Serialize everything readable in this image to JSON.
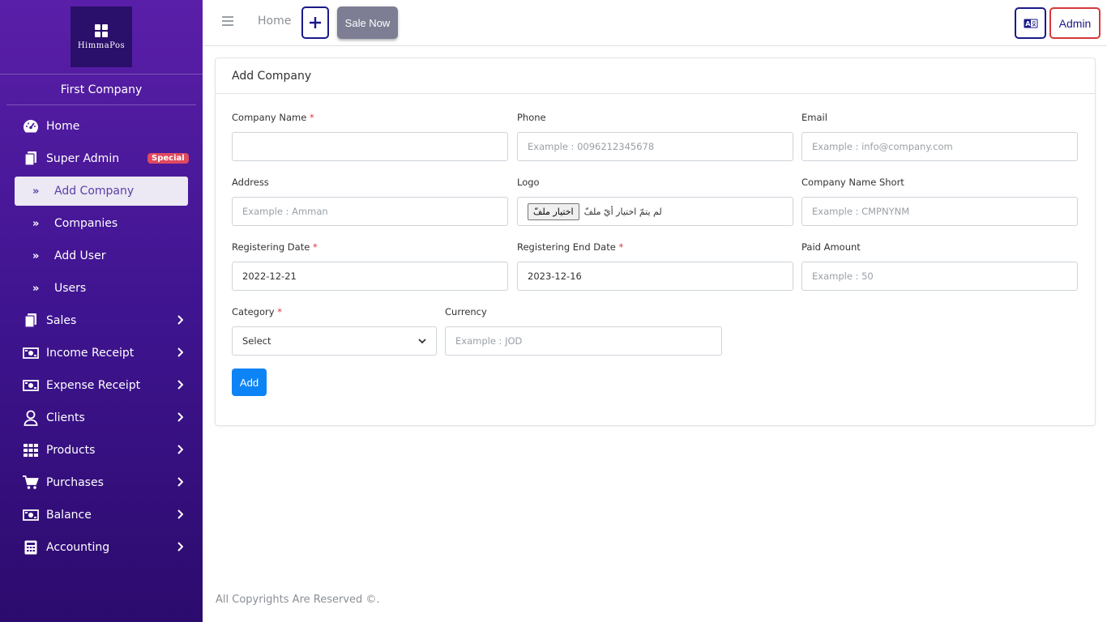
{
  "sidebar": {
    "logo_text": "HimmaPos",
    "company": "First Company",
    "items": [
      {
        "label": "Home",
        "icon": "dashboard-icon"
      },
      {
        "label": "Super Admin",
        "icon": "copy-icon",
        "badge": "Special"
      }
    ],
    "sub_items": [
      {
        "label": "Add Company"
      },
      {
        "label": "Companies"
      },
      {
        "label": "Add User"
      },
      {
        "label": "Users"
      }
    ],
    "menu": [
      {
        "label": "Sales",
        "icon": "copy-icon"
      },
      {
        "label": "Income Receipt",
        "icon": "money-icon"
      },
      {
        "label": "Expense Receipt",
        "icon": "money-icon"
      },
      {
        "label": "Clients",
        "icon": "user-icon"
      },
      {
        "label": "Products",
        "icon": "grid-icon"
      },
      {
        "label": "Purchases",
        "icon": "cart-icon"
      },
      {
        "label": "Balance",
        "icon": "money-icon"
      },
      {
        "label": "Accounting",
        "icon": "calculator-icon"
      }
    ]
  },
  "topbar": {
    "home": "Home",
    "sale_now": "Sale Now",
    "admin": "Admin"
  },
  "form": {
    "title": "Add Company",
    "company_name": {
      "label": "Company Name",
      "required": "*",
      "value": ""
    },
    "phone": {
      "label": "Phone",
      "placeholder": "Example : 0096212345678"
    },
    "email": {
      "label": "Email",
      "placeholder": "Example : info@company.com"
    },
    "address": {
      "label": "Address",
      "placeholder": "Example : Amman"
    },
    "logo": {
      "label": "Logo",
      "button": "اختيار ملفّ",
      "status": "لم يتمّ اختيار أيّ ملفّ"
    },
    "short_name": {
      "label": "Company Name Short",
      "placeholder": "Example : CMPNYNM"
    },
    "reg_date": {
      "label": "Registering Date",
      "required": "*",
      "value": "2022-12-21"
    },
    "reg_end_date": {
      "label": "Registering End Date",
      "required": "*",
      "value": "2023-12-16"
    },
    "paid_amount": {
      "label": "Paid Amount",
      "placeholder": "Example : 50"
    },
    "category": {
      "label": "Category",
      "required": "*",
      "value": "Select"
    },
    "currency": {
      "label": "Currency",
      "placeholder": "Example : JOD"
    },
    "submit": "Add"
  },
  "footer": "All Copyrights Are Reserved ©."
}
